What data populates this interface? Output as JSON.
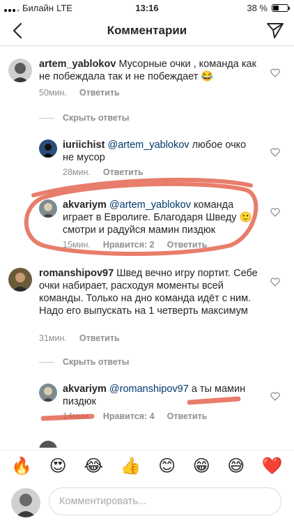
{
  "status": {
    "carrier": "Билайн",
    "network": "LTE",
    "time": "13:16",
    "battery_text": "38 %",
    "battery_level": 0.38
  },
  "header": {
    "title": "Комментарии",
    "back_icon": "chevron-left-icon",
    "send_icon": "paper-plane-icon"
  },
  "comments": [
    {
      "user": "artem_yablokov",
      "mention": "",
      "text": "Мусорные очки , команда как не побеждала так и не побеждает 😂",
      "time": "50мин.",
      "likes": "",
      "reply": "Ответить"
    },
    {
      "user": "iuriichist",
      "mention": "@artem_yablokov",
      "text": "любое очко не мусор",
      "time": "28мин.",
      "likes": "",
      "reply": "Ответить"
    },
    {
      "user": "akvariym",
      "mention": "@artem_yablokov",
      "text": "команда играет в Евролиге. Благодаря Шведу 🙂 смотри и радуйся мамин пиздюк",
      "time": "15мин.",
      "likes": "Нравится: 2",
      "reply": "Ответить"
    },
    {
      "user": "romanshipov97",
      "mention": "",
      "text": "Швед вечно игру портит. Себе очки набирает, расходуя моменты всей команды. Только на дно команда идёт с ним. Надо его выпускать на 1 четверть максимум",
      "time": "31мин.",
      "likes": "",
      "reply": "Ответить"
    },
    {
      "user": "akvariym",
      "mention": "@romanshipov97",
      "text": "а ты мамин пиздюк",
      "time": "14мин.",
      "likes": "Нравится: 4",
      "reply": "Ответить"
    }
  ],
  "hide_replies_label": "Скрыть ответы",
  "emojis": [
    "🔥",
    "😍",
    "😂",
    "👍",
    "😊",
    "😁",
    "😅",
    "❤️"
  ],
  "input": {
    "placeholder": "Комментировать..."
  },
  "colors": {
    "mention": "#00376b",
    "meta": "#8e8e8e",
    "annotation": "#e0523a",
    "separator": "#dbdbdb"
  }
}
